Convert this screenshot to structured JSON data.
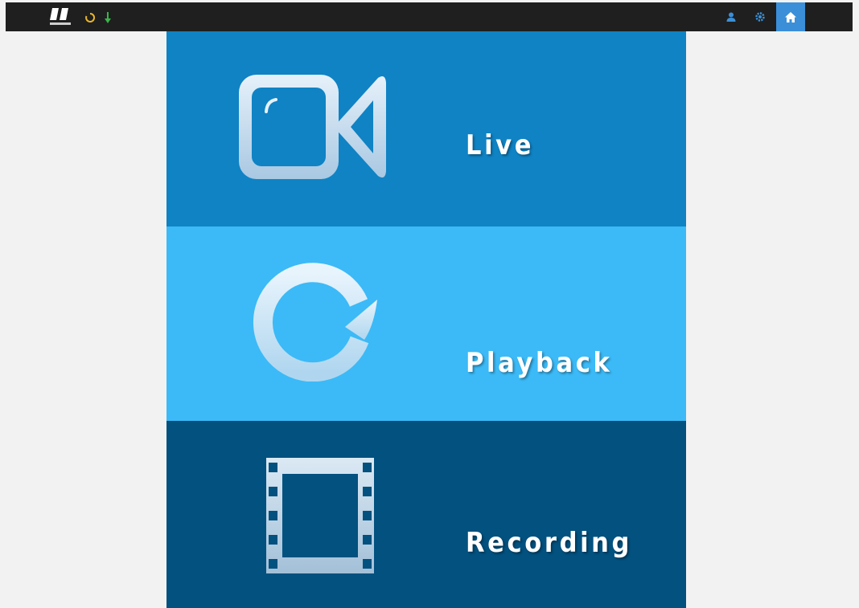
{
  "topbar": {
    "brand_text": "NUUO",
    "buttons": {
      "user_icon": "user-icon",
      "settings_icon": "gear-icon",
      "home_icon": "home-icon"
    },
    "status_icons": [
      "status-spinner-icon",
      "status-arrow-icon"
    ]
  },
  "menu": {
    "tiles": [
      {
        "label": "Live",
        "icon": "video-camera-icon",
        "color": "#0f83c4"
      },
      {
        "label": "Playback",
        "icon": "refresh-arrow-icon",
        "color": "#3bbaf7"
      },
      {
        "label": "Recording",
        "icon": "film-strip-icon",
        "color": "#02517f"
      }
    ]
  },
  "colors": {
    "topbar": "#1f1f1f",
    "home_button": "#3a8fd8",
    "page_background": "#f2f2f2",
    "icon_fill": "#c7dced"
  }
}
